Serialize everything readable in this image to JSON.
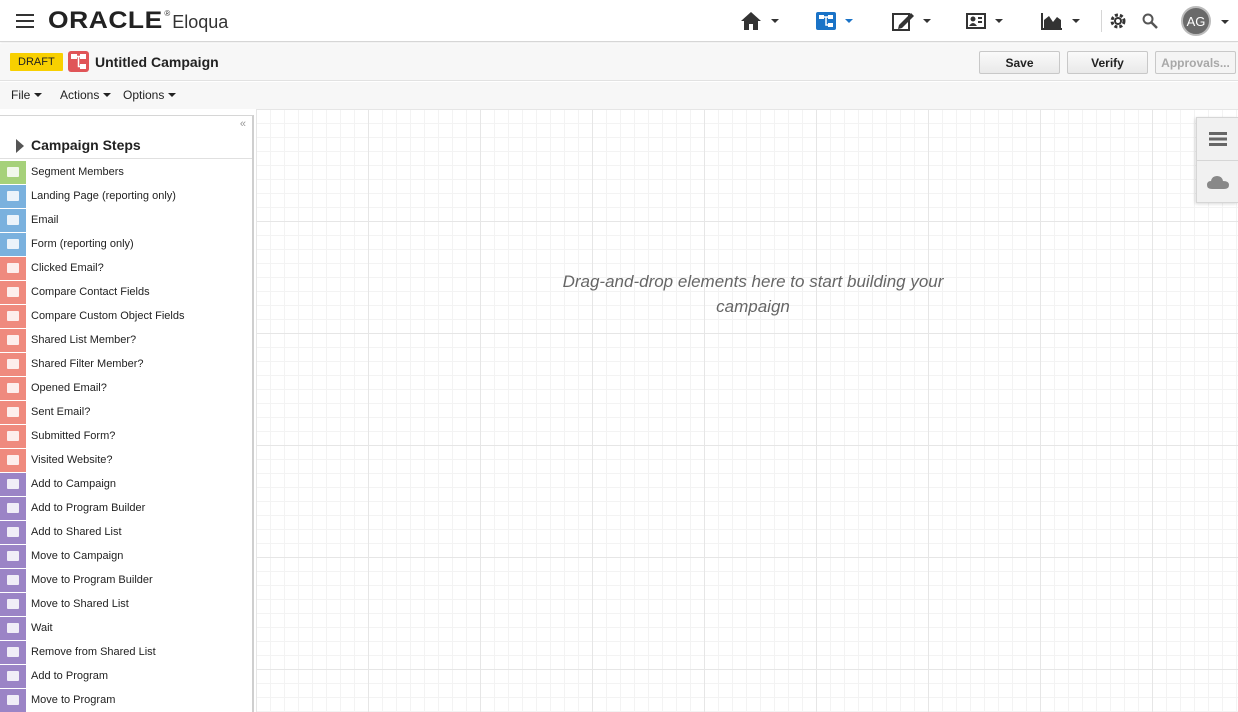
{
  "header": {
    "brand": "ORACLE",
    "brand_mark": "®",
    "product": "Eloqua",
    "user_initials": "AG",
    "nav_icons": [
      "home-icon",
      "orchestration-icon",
      "assets-icon",
      "audience-icon",
      "analytics-icon",
      "settings-icon",
      "search-icon"
    ],
    "accent_color": "#1a73c7"
  },
  "titlebar": {
    "status_badge": "DRAFT",
    "campaign_name": "Untitled Campaign",
    "save_label": "Save",
    "verify_label": "Verify",
    "approvals_label": "Approvals..."
  },
  "menubar": {
    "file": "File",
    "actions": "Actions",
    "options": "Options"
  },
  "panel": {
    "collapse_glyph": "«",
    "title": "Campaign Steps",
    "steps": [
      {
        "label": "Segment Members",
        "color": "#a6d17a"
      },
      {
        "label": "Landing Page (reporting only)",
        "color": "#7ab1de"
      },
      {
        "label": "Email",
        "color": "#7ab1de"
      },
      {
        "label": "Form (reporting only)",
        "color": "#7ab1de"
      },
      {
        "label": "Clicked Email?",
        "color": "#ef8a7e"
      },
      {
        "label": "Compare Contact Fields",
        "color": "#ef8a7e"
      },
      {
        "label": "Compare Custom Object Fields",
        "color": "#ef8a7e"
      },
      {
        "label": "Shared List Member?",
        "color": "#ef8a7e"
      },
      {
        "label": "Shared Filter Member?",
        "color": "#ef8a7e"
      },
      {
        "label": "Opened Email?",
        "color": "#ef8a7e"
      },
      {
        "label": "Sent Email?",
        "color": "#ef8a7e"
      },
      {
        "label": "Submitted Form?",
        "color": "#ef8a7e"
      },
      {
        "label": "Visited Website?",
        "color": "#ef8a7e"
      },
      {
        "label": "Add to Campaign",
        "color": "#9b84c6"
      },
      {
        "label": "Add to Program Builder",
        "color": "#9b84c6"
      },
      {
        "label": "Add to Shared List",
        "color": "#9b84c6"
      },
      {
        "label": "Move to Campaign",
        "color": "#9b84c6"
      },
      {
        "label": "Move to Program Builder",
        "color": "#9b84c6"
      },
      {
        "label": "Move to Shared List",
        "color": "#9b84c6"
      },
      {
        "label": "Wait",
        "color": "#9b84c6"
      },
      {
        "label": "Remove from Shared List",
        "color": "#9b84c6"
      },
      {
        "label": "Add to Program",
        "color": "#9b84c6"
      },
      {
        "label": "Move to Program",
        "color": "#9b84c6"
      }
    ]
  },
  "canvas": {
    "hint": "Drag-and-drop elements here to start building your campaign"
  }
}
